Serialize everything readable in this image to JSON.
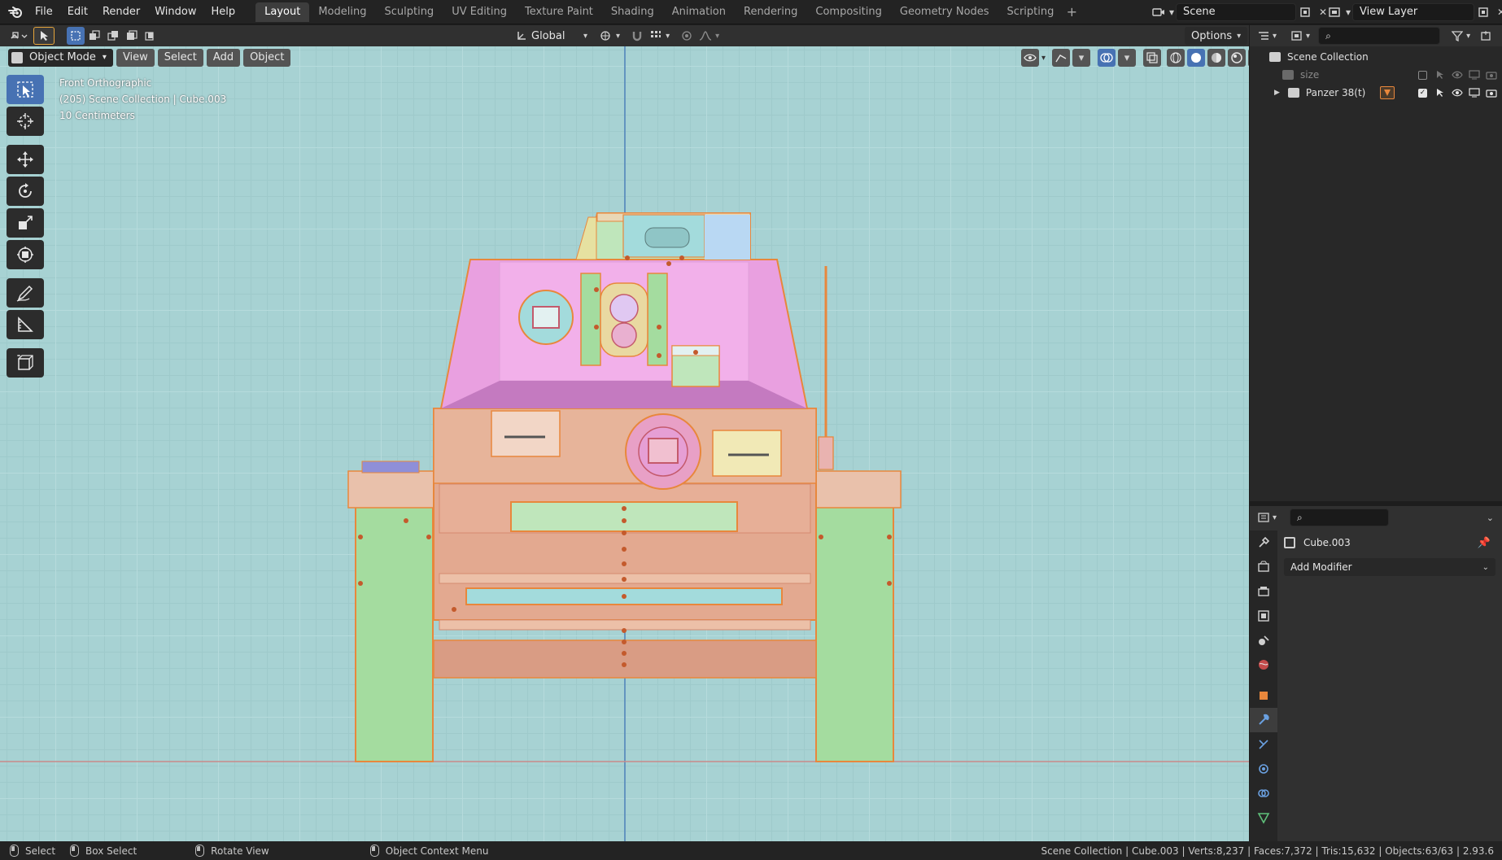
{
  "menu": {
    "items": [
      "File",
      "Edit",
      "Render",
      "Window",
      "Help"
    ]
  },
  "workspaces": {
    "tabs": [
      "Layout",
      "Modeling",
      "Sculpting",
      "UV Editing",
      "Texture Paint",
      "Shading",
      "Animation",
      "Rendering",
      "Compositing",
      "Geometry Nodes",
      "Scripting"
    ],
    "active": "Layout"
  },
  "scene": {
    "name": "Scene"
  },
  "view_layer": {
    "name": "View Layer"
  },
  "viewport_header": {
    "orientation": "Global",
    "options_label": "Options",
    "mode": "Object Mode",
    "view_label": "View",
    "select_label": "Select",
    "add_label": "Add",
    "object_label": "Object"
  },
  "viewport_info": {
    "line1": "Front Orthographic",
    "line2": "(205) Scene Collection | Cube.003",
    "line3": "10 Centimeters"
  },
  "outliner": {
    "root": "Scene Collection",
    "items": [
      {
        "label": "size"
      },
      {
        "label": "Panzer 38(t)"
      }
    ]
  },
  "properties": {
    "object_name": "Cube.003",
    "add_modifier_label": "Add Modifier"
  },
  "statusbar": {
    "select": "Select",
    "box_select": "Box Select",
    "rotate_view": "Rotate View",
    "context_menu": "Object Context Menu",
    "stats": "Scene Collection | Cube.003 | Verts:8,237 | Faces:7,372 | Tris:15,632 | Objects:63/63 | 2.93.6"
  },
  "colors": {
    "viewport_bg": "#a7d2d3",
    "accent": "#4772b3",
    "turret": "#e59ed8",
    "hull": "#e3aa91",
    "tracks": "#a6e0a2",
    "selection_outline": "#e8873c"
  }
}
